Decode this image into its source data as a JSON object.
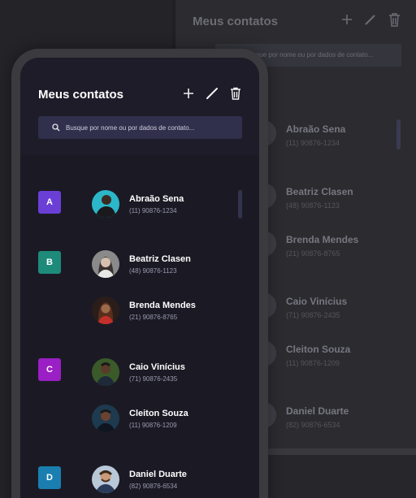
{
  "background": {
    "title": "Meus contatos",
    "search_placeholder": "Busque por nome ou por dados de contato...",
    "contacts": [
      {
        "name": "Abraão Sena",
        "phone": "(11) 90876-1234"
      },
      {
        "name": "Beatriz Clasen",
        "phone": "(48) 90876-1123"
      },
      {
        "name": "Brenda Mendes",
        "phone": "(21) 90876-8765"
      },
      {
        "name": "Caio Vinícius",
        "phone": "(71) 90876-2435"
      },
      {
        "name": "Cleiton Souza",
        "phone": "(11) 90876-1209"
      },
      {
        "name": "Daniel Duarte",
        "phone": "(82) 90876-6534"
      }
    ]
  },
  "app": {
    "title": "Meus contatos",
    "search_placeholder": "Busque por nome ou por dados de contato...",
    "actions": {
      "add": "plus-icon",
      "edit": "pencil-icon",
      "delete": "trash-icon"
    }
  },
  "groups": [
    {
      "letter": "A",
      "color": "#6a3fd6"
    },
    {
      "letter": "B",
      "color": "#1d8a7a"
    },
    {
      "letter": "C",
      "color": "#9a1fc4"
    },
    {
      "letter": "D",
      "color": "#1a7fb0"
    }
  ],
  "contacts": [
    {
      "name": "Abraão Sena",
      "phone": "(11) 90876-1234"
    },
    {
      "name": "Beatriz Clasen",
      "phone": "(48) 90876-1123"
    },
    {
      "name": "Brenda Mendes",
      "phone": "(21) 90876-8765"
    },
    {
      "name": "Caio Vinícius",
      "phone": "(71) 90876-2435"
    },
    {
      "name": "Cleiton Souza",
      "phone": "(11) 90876-1209"
    },
    {
      "name": "Daniel Duarte",
      "phone": "(82) 90876-6534"
    }
  ]
}
